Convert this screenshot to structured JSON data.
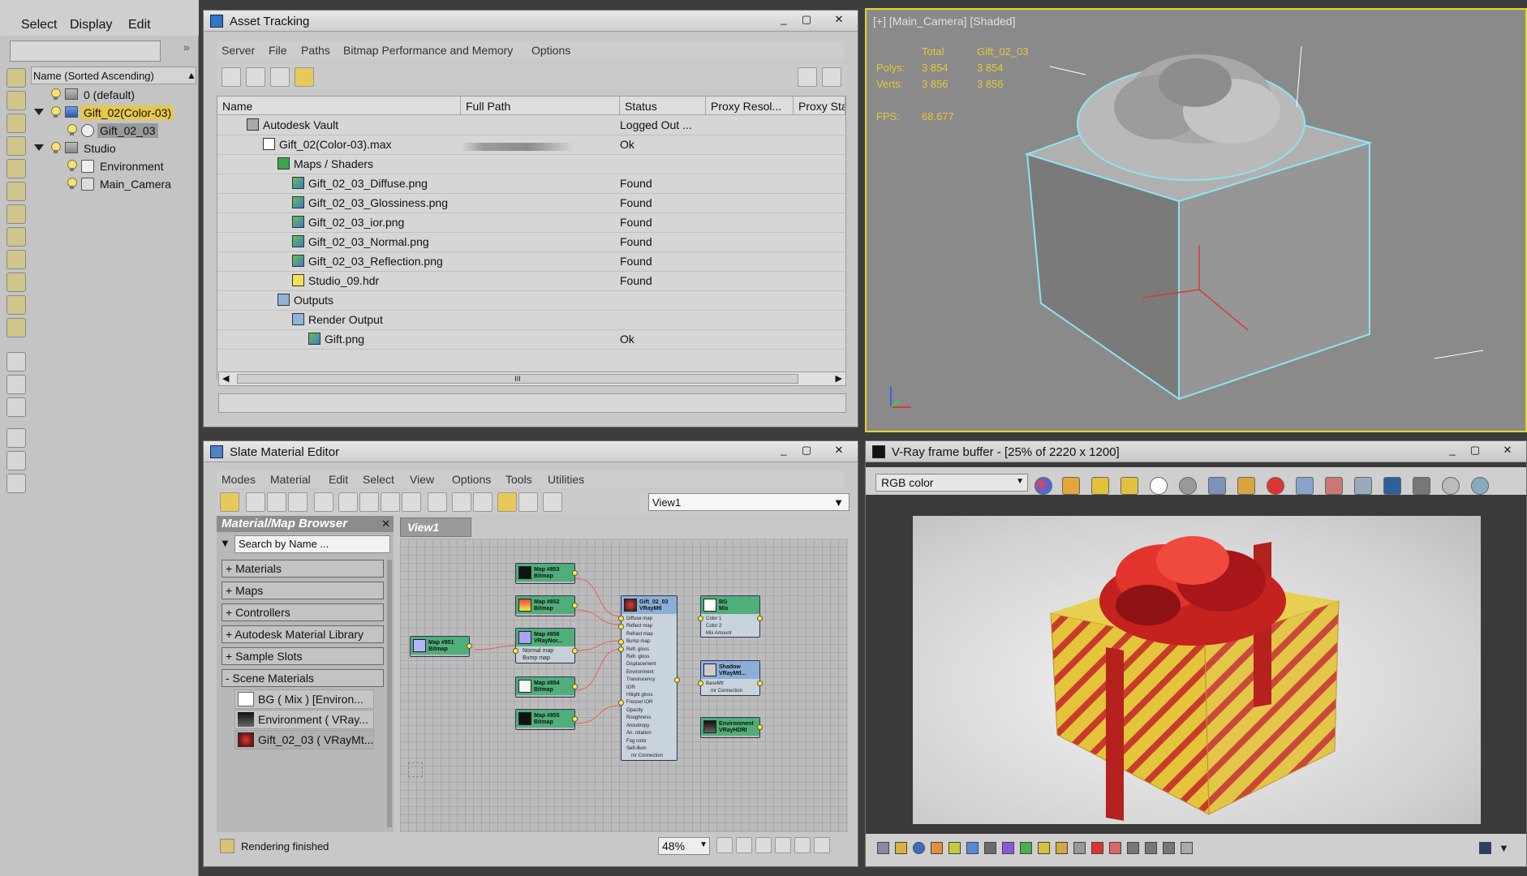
{
  "scene_explorer": {
    "menu": [
      "Select",
      "Display",
      "Edit"
    ],
    "column_header": "Name (Sorted Ascending)",
    "tree": [
      {
        "label": "0 (default)",
        "depth": 0
      },
      {
        "label": "Gift_02(Color-03)",
        "depth": 0
      },
      {
        "label": "Gift_02_03",
        "depth": 1
      },
      {
        "label": "Studio",
        "depth": 0
      },
      {
        "label": "Environment",
        "depth": 1
      },
      {
        "label": "Main_Camera",
        "depth": 1
      }
    ]
  },
  "asset_tracking": {
    "title": "Asset Tracking",
    "menu": [
      "Server",
      "File",
      "Paths",
      "Bitmap Performance and Memory",
      "Options"
    ],
    "columns": [
      "Name",
      "Full Path",
      "Status",
      "Proxy Resol...",
      "Proxy Stat"
    ],
    "rows": [
      {
        "name": "Autodesk Vault",
        "status": "Logged Out ..."
      },
      {
        "name": "Gift_02(Color-03).max",
        "status": "Ok"
      },
      {
        "name": "Maps / Shaders",
        "status": ""
      },
      {
        "name": "Gift_02_03_Diffuse.png",
        "status": "Found"
      },
      {
        "name": "Gift_02_03_Glossiness.png",
        "status": "Found"
      },
      {
        "name": "Gift_02_03_ior.png",
        "status": "Found"
      },
      {
        "name": "Gift_02_03_Normal.png",
        "status": "Found"
      },
      {
        "name": "Gift_02_03_Reflection.png",
        "status": "Found"
      },
      {
        "name": "Studio_09.hdr",
        "status": "Found"
      },
      {
        "name": "Outputs",
        "status": ""
      },
      {
        "name": "Render Output",
        "status": ""
      },
      {
        "name": "Gift.png",
        "status": "Ok"
      }
    ],
    "scroll_marker": "III"
  },
  "viewport": {
    "label": "[+] [Main_Camera] [Shaded]",
    "stats": {
      "total_label": "Total",
      "object_label": "Gift_02_03",
      "polys_label": "Polys:",
      "polys_total": "3 854",
      "polys_object": "3 854",
      "verts_label": "Verts:",
      "verts_total": "3 856",
      "verts_object": "3 856",
      "fps_label": "FPS:",
      "fps_value": "68.677"
    }
  },
  "slate": {
    "title": "Slate Material Editor",
    "menu": [
      "Modes",
      "Material",
      "Edit",
      "Select",
      "View",
      "Options",
      "Tools",
      "Utilities"
    ],
    "view_select": "View1",
    "browser_title": "Material/Map Browser",
    "search_placeholder": "Search by Name ...",
    "rollouts": [
      "+ Materials",
      "+ Maps",
      "+ Controllers",
      "+ Autodesk Material Library",
      "+ Sample Slots",
      "- Scene Materials"
    ],
    "scene_materials": [
      "BG  ( Mix )  [Environ...",
      "Environment  ( VRay...",
      "Gift_02_03  ( VRayMt..."
    ],
    "view_tab": "View1",
    "status": "Rendering finished",
    "zoom": "48%",
    "nodes": [
      {
        "title": "Map #853",
        "sub": "Bitmap"
      },
      {
        "title": "Map #852",
        "sub": "Bitmap"
      },
      {
        "title": "Map #856",
        "sub": "VRayNor..."
      },
      {
        "title": "Map #851",
        "sub": "Bitmap"
      },
      {
        "title": "Map #854",
        "sub": "Bitmap"
      },
      {
        "title": "Map #855",
        "sub": "Bitmap"
      },
      {
        "title": "Gift_02_03",
        "sub": "VRayMtl"
      },
      {
        "title": "BG",
        "sub": "Mix"
      },
      {
        "title": "Shadow",
        "sub": "VRayMtl..."
      },
      {
        "title": "Environment",
        "sub": "VRayHDRI"
      }
    ],
    "vraymtl_slots": [
      "Diffuse map",
      "Reflect map",
      "Refract map",
      "Bump map",
      "Refl. gloss",
      "Refr. gloss",
      "Displacement",
      "Environment",
      "Translucency",
      "IOR",
      "Hilight gloss",
      "Fresnel IOR",
      "Opacity",
      "Roughness",
      "Anisotropy",
      "An. rotation",
      "Fog color",
      "Self-illum",
      "mr Connection"
    ],
    "normal_slots": [
      "Normal map",
      "Bump map"
    ],
    "mix_slots": [
      "Color 1",
      "Color 2",
      "Mix Amount"
    ],
    "shadow_slots": [
      "BaseMtl",
      "mr Connection"
    ]
  },
  "vfb": {
    "title": "V-Ray frame buffer - [25% of 2220 x 1200]",
    "channel": "RGB color"
  },
  "colors": {
    "viewport_border": "#e7d52c",
    "selection": "#e6c84d",
    "node_header": "#4fae79",
    "port": "#ffef2f",
    "wire": "#e36a6a"
  }
}
